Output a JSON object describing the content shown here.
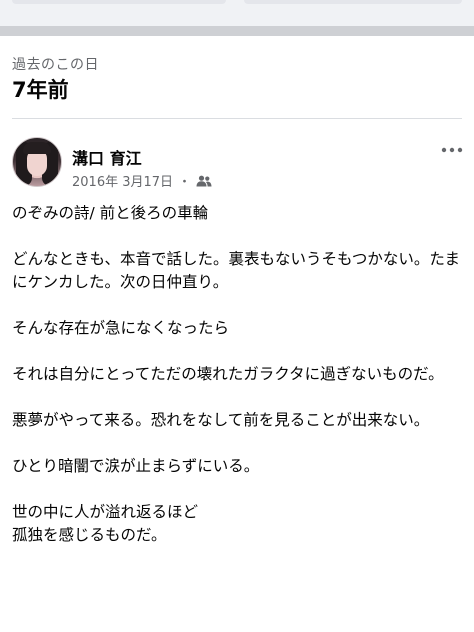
{
  "memories": {
    "section_label": "過去のこの日",
    "years_ago": "7年前"
  },
  "post": {
    "author": "溝口 育江",
    "date": "2016年 3月17日",
    "separator": "・",
    "audience_icon": "friends-icon",
    "more_icon": "more-options-icon",
    "paragraphs": [
      "のぞみの詩/ 前と後ろの車輪",
      "どんなときも、本音で話した。裏表もないうそもつかない。たまにケンカした。次の日仲直り。",
      "そんな存在が急になくなったら",
      "それは自分にとってただの壊れたガラクタに過ぎないものだ。",
      "悪夢がやって来る。恐れをなして前を見ることが出来ない。",
      "ひとり暗闇で涙が止まらずにいる。",
      "世の中に人が溢れ返るほど\n孤独を感じるものだ。"
    ]
  }
}
